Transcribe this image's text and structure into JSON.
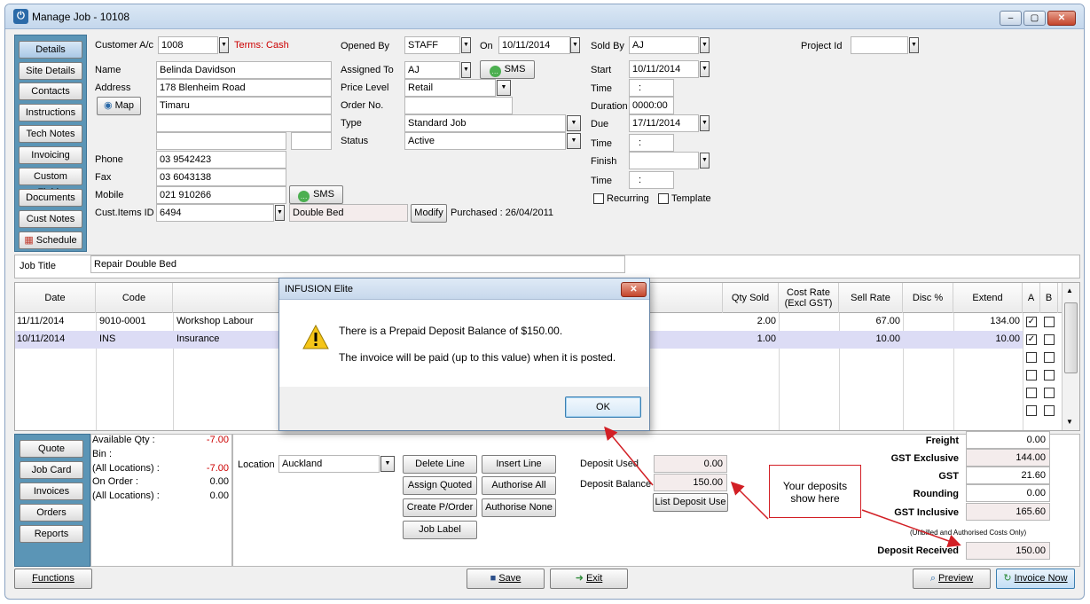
{
  "window": {
    "title": "Manage Job - 10108",
    "controls": [
      "minimize",
      "maximize",
      "close"
    ]
  },
  "nav": {
    "items": [
      "Details",
      "Site Details",
      "Contacts",
      "Instructions",
      "Tech Notes",
      "Invoicing",
      "Custom Fields",
      "Documents",
      "Cust Notes",
      "Schedule"
    ]
  },
  "customer": {
    "account_label": "Customer A/c",
    "account": "1008",
    "terms": "Terms: Cash",
    "name_label": "Name",
    "name": "Belinda Davidson",
    "address_label": "Address",
    "address1": "178 Blenheim Road",
    "address2": "Timaru",
    "address3": "",
    "address4": "",
    "postcode": "",
    "map_label": "Map",
    "phone_label": "Phone",
    "phone": "03 9542423",
    "fax_label": "Fax",
    "fax": "03 6043138",
    "mobile_label": "Mobile",
    "mobile": "021 910266",
    "sms_label": "SMS",
    "items_label": "Cust.Items ID",
    "items_id": "6494",
    "item_desc": "Double Bed",
    "modify_label": "Modify",
    "purchased": "Purchased : 26/04/2011"
  },
  "job": {
    "opened_by_label": "Opened By",
    "opened_by": "STAFF",
    "on_label": "On",
    "on": "10/11/2014",
    "assigned_label": "Assigned To",
    "assigned": "AJ",
    "sms_label": "SMS",
    "price_level_label": "Price Level",
    "price_level": "Retail",
    "order_label": "Order No.",
    "order": "",
    "type_label": "Type",
    "type": "Standard Job",
    "status_label": "Status",
    "status": "Active",
    "sold_by_label": "Sold By",
    "sold_by": "AJ",
    "project_label": "Project Id",
    "project": "",
    "start_label": "Start",
    "start": "10/11/2014",
    "time_label": "Time",
    "start_time": ":",
    "duration_label": "Duration",
    "duration": "0000:00",
    "due_label": "Due",
    "due": "17/11/2014",
    "due_time": ":",
    "finish_label": "Finish",
    "finish": "",
    "finish_time": ":",
    "recurring_label": "Recurring",
    "template_label": "Template",
    "title_label": "Job Title",
    "title": "Repair Double Bed"
  },
  "grid": {
    "headers": [
      "Date",
      "Code",
      "",
      "Qty Sold",
      "Cost Rate (Excl GST)",
      "Sell Rate",
      "Disc %",
      "Extend",
      "A",
      "B"
    ],
    "rows": [
      {
        "date": "11/11/2014",
        "code": "9010-0001",
        "desc": "Workshop Labour",
        "qty": "2.00",
        "cost": "",
        "sell": "67.00",
        "disc": "",
        "extend": "134.00",
        "a": true,
        "b": false
      },
      {
        "date": "10/11/2014",
        "code": "INS",
        "desc": "Insurance",
        "qty": "1.00",
        "cost": "",
        "sell": "10.00",
        "disc": "",
        "extend": "10.00",
        "a": true,
        "b": false
      }
    ]
  },
  "bottom_nav": {
    "items": [
      "Quote",
      "Job Card",
      "Invoices",
      "Orders",
      "Reports"
    ]
  },
  "stock": {
    "available_label": "Available Qty :",
    "available": "-7.00",
    "bin_label": "Bin :",
    "all_loc_label": "(All Locations) :",
    "all_loc": "-7.00",
    "on_order_label": "On Order :",
    "on_order": "0.00",
    "all_loc2_label": "(All Locations) :",
    "all_loc2": "0.00"
  },
  "actions": {
    "location_label": "Location",
    "location": "Auckland",
    "delete_line": "Delete Line",
    "insert_line": "Insert Line",
    "assign_quoted": "Assign Quoted",
    "authorise_all": "Authorise All",
    "create_po": "Create P/Order",
    "authorise_none": "Authorise None",
    "job_label": "Job Label"
  },
  "deposit": {
    "used_label": "Deposit Used",
    "used": "0.00",
    "balance_label": "Deposit Balance",
    "balance": "150.00",
    "list_label": "List Deposit Use"
  },
  "totals": {
    "freight_label": "Freight",
    "freight": "0.00",
    "gst_excl_label": "GST Exclusive",
    "gst_excl": "144.00",
    "gst_label": "GST",
    "gst": "21.60",
    "rounding_label": "Rounding",
    "rounding": "0.00",
    "gst_incl_label": "GST Inclusive",
    "gst_incl": "165.60",
    "note": "(Unbilled and Authorised Costs Only)",
    "deposit_received_label": "Deposit Received",
    "deposit_received": "150.00"
  },
  "footer": {
    "functions": "Functions",
    "save": "Save",
    "exit": "Exit",
    "preview": "Preview",
    "invoice_now": "Invoice Now"
  },
  "dialog": {
    "title": "INFUSION Elite",
    "line1": "There is a Prepaid Deposit Balance of $150.00.",
    "line2": "The invoice will be paid (up to this value) when it is posted.",
    "ok": "OK"
  },
  "callout": {
    "text": "Your deposits show here"
  },
  "colors": {
    "nav_bg": "#5b95b6",
    "terms": "#cc0000",
    "arrow": "#d21f25",
    "selected_row": "#dcdcf5"
  }
}
